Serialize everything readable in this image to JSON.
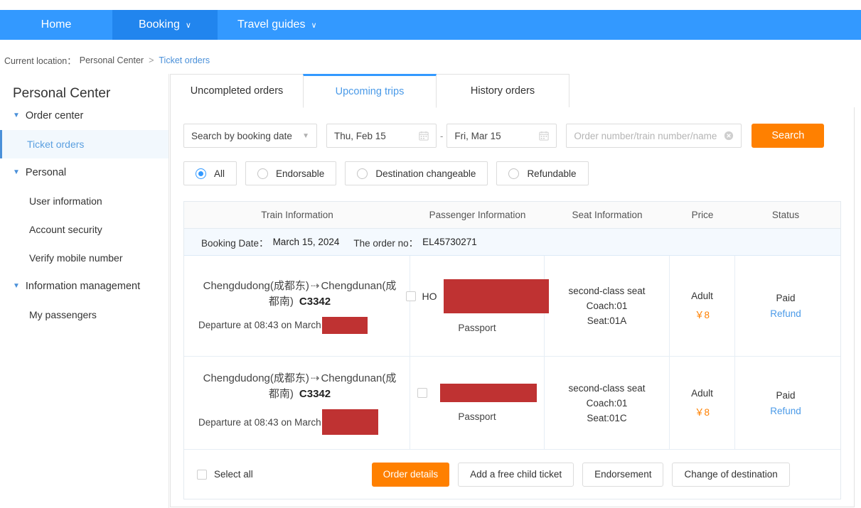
{
  "nav": {
    "items": [
      {
        "label": "Home",
        "caret": false,
        "active": false
      },
      {
        "label": "Booking",
        "caret": true,
        "active": true
      },
      {
        "label": "Travel guides",
        "caret": true,
        "active": false
      }
    ],
    "caret_glyph": "∨"
  },
  "breadcrumb": {
    "label": "Current location：",
    "parent": "Personal Center",
    "separator": ">",
    "current": "Ticket orders"
  },
  "sidebar": {
    "title": "Personal Center",
    "groups": [
      {
        "label": "Order center"
      },
      {
        "label": "Personal"
      },
      {
        "label": "Information management"
      }
    ],
    "links": {
      "ticket_orders": "Ticket orders",
      "user_information": "User information",
      "account_security": "Account security",
      "verify_mobile_number": "Verify mobile number",
      "my_passengers": "My passengers"
    }
  },
  "tabs": [
    {
      "label": "Uncompleted orders",
      "active": false
    },
    {
      "label": "Upcoming trips",
      "active": true
    },
    {
      "label": "History orders",
      "active": false
    }
  ],
  "filters": {
    "search_mode": "Search by booking date",
    "date_from": "Thu, Feb 15",
    "date_to": "Fri, Mar 15",
    "date_separator": "-",
    "keyword_value": "",
    "keyword_placeholder": "Order number/train number/name",
    "search_button": "Search",
    "radios": [
      {
        "label": "All",
        "selected": true
      },
      {
        "label": "Endorsable",
        "selected": false
      },
      {
        "label": "Destination changeable",
        "selected": false
      },
      {
        "label": "Refundable",
        "selected": false
      }
    ]
  },
  "table": {
    "headers": {
      "train": "Train Information",
      "passenger": "Passenger Information",
      "seat": "Seat Information",
      "price": "Price",
      "status": "Status"
    },
    "order": {
      "booking_date_label": "Booking Date：",
      "booking_date_value": "March 15, 2024",
      "order_no_label": "The order no：",
      "order_no_value": "EL45730271"
    },
    "rows": [
      {
        "from": "Chengdudong(成都东)",
        "arrow": "⇢",
        "to": "Chengdunan(成都南)",
        "train_no": "C3342",
        "departure": "Departure at 08:43 on March",
        "departure_redacted": true,
        "passenger_name_visible": "HO",
        "passenger_name_redacted": true,
        "id_type": "Passport",
        "seat_class": "second-class seat",
        "coach": "Coach:01",
        "seat": "Seat:01A",
        "price_type": "Adult",
        "price_amount": "￥8",
        "status": "Paid",
        "status_action": "Refund"
      },
      {
        "from": "Chengdudong(成都东)",
        "arrow": "⇢",
        "to": "Chengdunan(成都南)",
        "train_no": "C3342",
        "departure": "Departure at 08:43 on March",
        "departure_redacted": true,
        "passenger_name_visible": "",
        "passenger_name_redacted": true,
        "id_type": "Passport",
        "seat_class": "second-class seat",
        "coach": "Coach:01",
        "seat": "Seat:01C",
        "price_type": "Adult",
        "price_amount": "￥8",
        "status": "Paid",
        "status_action": "Refund"
      }
    ]
  },
  "footer": {
    "select_all": "Select all",
    "order_details": "Order details",
    "add_child_ticket": "Add a free child ticket",
    "endorsement": "Endorsement",
    "change_destination": "Change of destination"
  },
  "colors": {
    "nav_blue": "#3399ff",
    "nav_active_blue": "#2185ee",
    "accent_orange": "#ff8000",
    "link_blue": "#4a9ae8",
    "redaction_red": "#bf3232"
  }
}
